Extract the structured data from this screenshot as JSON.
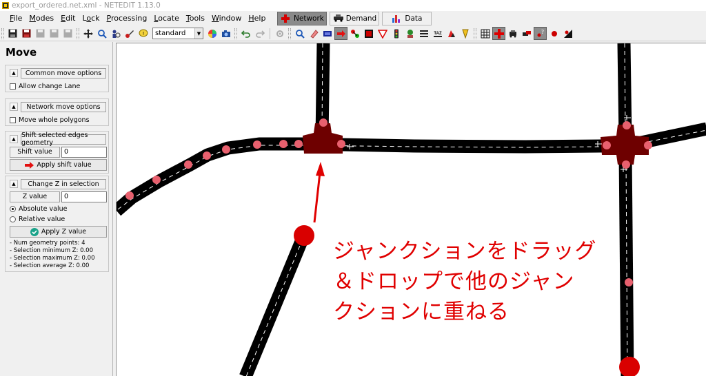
{
  "window": {
    "title": "export_ordered.net.xml - NETEDIT 1.13.0"
  },
  "menu": {
    "items": [
      {
        "label": "File",
        "underline": "F"
      },
      {
        "label": "Modes",
        "underline": "M"
      },
      {
        "label": "Edit",
        "underline": "E"
      },
      {
        "label": "Lock",
        "underline": "o"
      },
      {
        "label": "Processing",
        "underline": "P"
      },
      {
        "label": "Locate",
        "underline": "L"
      },
      {
        "label": "Tools",
        "underline": "T"
      },
      {
        "label": "Window",
        "underline": "W"
      },
      {
        "label": "Help",
        "underline": "H"
      }
    ],
    "supermodes": [
      {
        "label": "Network",
        "active": true
      },
      {
        "label": "Demand",
        "active": false
      },
      {
        "label": "Data",
        "active": false
      }
    ]
  },
  "toolbar": {
    "scheme_select_value": "standard"
  },
  "left_frame": {
    "title": "Move",
    "common_move_options": {
      "title": "Common move options",
      "allow_change_lane": "Allow change Lane"
    },
    "network_move_options": {
      "title": "Network move options",
      "move_whole_polygons": "Move whole polygons"
    },
    "shift_edges": {
      "title": "Shift selected edges geometry",
      "shift_label": "Shift value",
      "shift_value": "0",
      "apply_label": "Apply shift value"
    },
    "change_z": {
      "title": "Change Z in selection",
      "z_label": "Z value",
      "z_value": "0",
      "absolute_label": "Absolute value",
      "relative_label": "Relative value",
      "apply_label": "Apply Z value",
      "info": [
        "- Num geometry points: 4",
        "- Selection minimum Z: 0.00",
        "- Selection maximum Z: 0.00",
        "- Selection average Z: 0.00"
      ]
    }
  },
  "canvas": {
    "annotation": "ジャンクションをドラッグ\n＆ドロップで他のジャン\nクションに重ねる",
    "colors": {
      "road": "#000000",
      "junction": "#6e0000",
      "geometry_point": "#e8606e",
      "dragged_junction": "#d90000",
      "arrow": "#e00000"
    }
  }
}
